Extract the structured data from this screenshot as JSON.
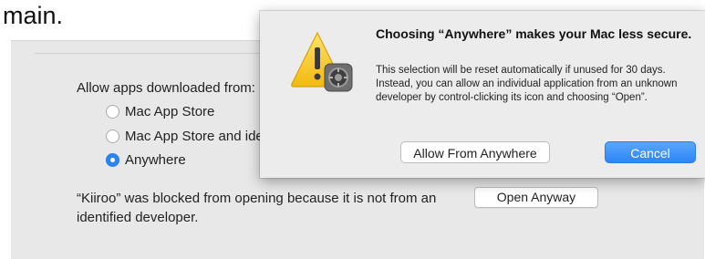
{
  "top_text": "main.",
  "panel": {
    "allow_label": "Allow apps downloaded from:",
    "radio_options": [
      {
        "label": "Mac App Store",
        "selected": false
      },
      {
        "label": "Mac App Store and identified developers",
        "selected": false
      },
      {
        "label": "Anywhere",
        "selected": true
      }
    ],
    "blocked_text": "“Kiiroo” was blocked from opening because it is not from an identified developer.",
    "open_anyway_label": "Open Anyway"
  },
  "dialog": {
    "title": "Choosing “Anywhere” makes your Mac less secure.",
    "body": "This selection will be reset automatically if unused for 30 days. Instead, you can allow an individual application from an unknown developer by control-clicking its icon and choosing “Open”.",
    "allow_button": "Allow From Anywhere",
    "cancel_button": "Cancel",
    "icon": "warning-icon",
    "badge_icon": "system-preferences-gear-icon"
  },
  "colors": {
    "accent": "#2b84f5",
    "panel_bg": "#e8e8e8",
    "dialog_bg": "#ececec",
    "warning_yellow": "#f5c518"
  }
}
